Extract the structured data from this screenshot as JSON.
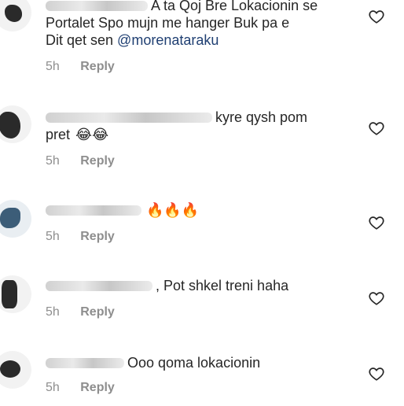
{
  "comments": [
    {
      "line1": "A ta Qoj Bre Lokacionin se",
      "line2": "Portalet Spo mujn me hanger Buk pa e",
      "line3_prefix": "Dit qet sen ",
      "mention": "@morenataraku",
      "time": "5h",
      "reply": "Reply"
    },
    {
      "line1": "kyre qysh pom",
      "line2": "pret",
      "emoji": "😂😂",
      "time": "5h",
      "reply": "Reply"
    },
    {
      "emoji": "🔥🔥🔥",
      "time": "5h",
      "reply": "Reply"
    },
    {
      "line1": ", Pot shkel treni haha",
      "time": "5h",
      "reply": "Reply"
    },
    {
      "line1": "Ooo qoma lokacionin",
      "time": "5h",
      "reply": "Reply"
    }
  ],
  "icons": {
    "like": "heart-outline-icon"
  },
  "colors": {
    "text": "#262626",
    "meta": "#8e8e8e",
    "mention": "#1f3f72"
  }
}
